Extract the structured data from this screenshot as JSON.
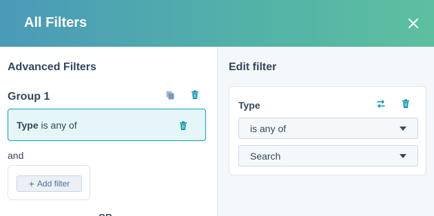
{
  "header": {
    "title": "All Filters"
  },
  "left": {
    "title": "Advanced Filters",
    "group": {
      "title": "Group 1",
      "filter": {
        "property": "Type",
        "operator": "is any of"
      }
    },
    "and_label": "and",
    "add_filter_label": "Add filter",
    "or_label": "OR"
  },
  "right": {
    "title": "Edit filter",
    "property_label": "Type",
    "operator_select": {
      "value": "is any of"
    },
    "value_select": {
      "value": "Search"
    }
  },
  "colors": {
    "header_start": "#4a9ab8",
    "header_end": "#5dbfa0",
    "accent": "#00a4bd",
    "text": "#33475b"
  }
}
